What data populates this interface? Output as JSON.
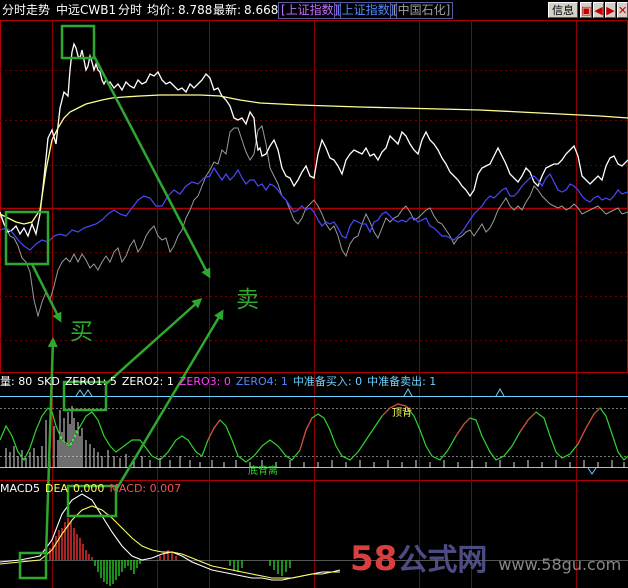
{
  "header": {
    "title": "分时走势",
    "stock_name": "中远CWB1",
    "period": "分时",
    "avg_label": "均价:",
    "avg_value": "8.788",
    "last_label": "最新:",
    "last_value": "8.668",
    "index_tab_1": "[上证指数]",
    "index_tab_2": "[上证指数]",
    "index_tab_3": "[中国石化]",
    "info_button": "信息",
    "colors": {
      "avg_line": "#ffff80",
      "price_line": "#ffffff",
      "index_line": "#4040ff"
    }
  },
  "window_buttons": [
    "info-button",
    "restore-icon",
    "prev-icon",
    "next-icon",
    "close-icon"
  ],
  "indicator1": {
    "vol": "量: 80",
    "skd": "SKD",
    "zero1": "ZERO1: 5",
    "zero2": "ZERO2: 1",
    "zero3": "ZERO3: 0",
    "zero4": "ZERO4: 1",
    "buy_prep": "中准备买入: 0",
    "sell_prep": "中准备卖出: 1",
    "annot_top": "顶背",
    "annot_bottom": "底背离"
  },
  "indicator2": {
    "macd5": "MACD5",
    "dea": "DEA",
    "dea_value": "0.000",
    "macd": "MACD: 0.007"
  },
  "annotations": {
    "buy": "买",
    "sell": "卖"
  },
  "watermark": {
    "num": "58",
    "text": "公式网",
    "url": "www.58gu.com"
  }
}
